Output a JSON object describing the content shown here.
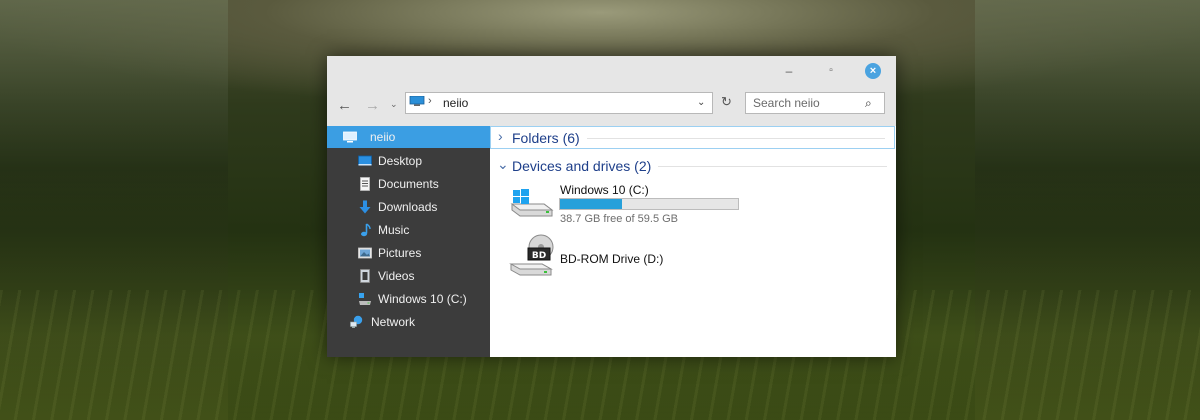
{
  "window": {
    "nav": {
      "back_symbol": "←",
      "forward_symbol": "→",
      "history_symbol": "⌄"
    },
    "address": {
      "separator": "›",
      "location": "neiio",
      "dropdown_symbol": "⌄",
      "refresh_symbol": "↻"
    },
    "search": {
      "placeholder": "Search neiio",
      "icon_symbol": "⌕"
    },
    "controls": {
      "minimize": "–",
      "maximize": "▫",
      "close": "×"
    }
  },
  "sidebar": {
    "items": [
      {
        "label": "neiio",
        "icon": "computer-icon",
        "selected": true
      },
      {
        "label": "Desktop",
        "icon": "desktop-icon"
      },
      {
        "label": "Documents",
        "icon": "documents-icon"
      },
      {
        "label": "Downloads",
        "icon": "downloads-icon"
      },
      {
        "label": "Music",
        "icon": "music-icon"
      },
      {
        "label": "Pictures",
        "icon": "pictures-icon"
      },
      {
        "label": "Videos",
        "icon": "videos-icon"
      },
      {
        "label": "Windows 10 (C:)",
        "icon": "drive-icon"
      },
      {
        "label": "Network",
        "icon": "network-icon"
      }
    ]
  },
  "content": {
    "folders_group": {
      "chevron": "›",
      "title": "Folders (6)"
    },
    "devices_group": {
      "chevron": "⌄",
      "title": "Devices and drives (2)"
    },
    "drives": [
      {
        "name": "Windows 10 (C:)",
        "free_text": "38.7 GB free of 59.5 GB",
        "used_fraction": 0.35
      },
      {
        "name": "BD-ROM Drive (D:)",
        "icon_label": "BD"
      }
    ]
  },
  "colors": {
    "accent": "#3b9ee3",
    "sidebar_bg": "#3c3c3c",
    "bar_fill": "#26a0da",
    "group_title": "#1e3f8a"
  }
}
